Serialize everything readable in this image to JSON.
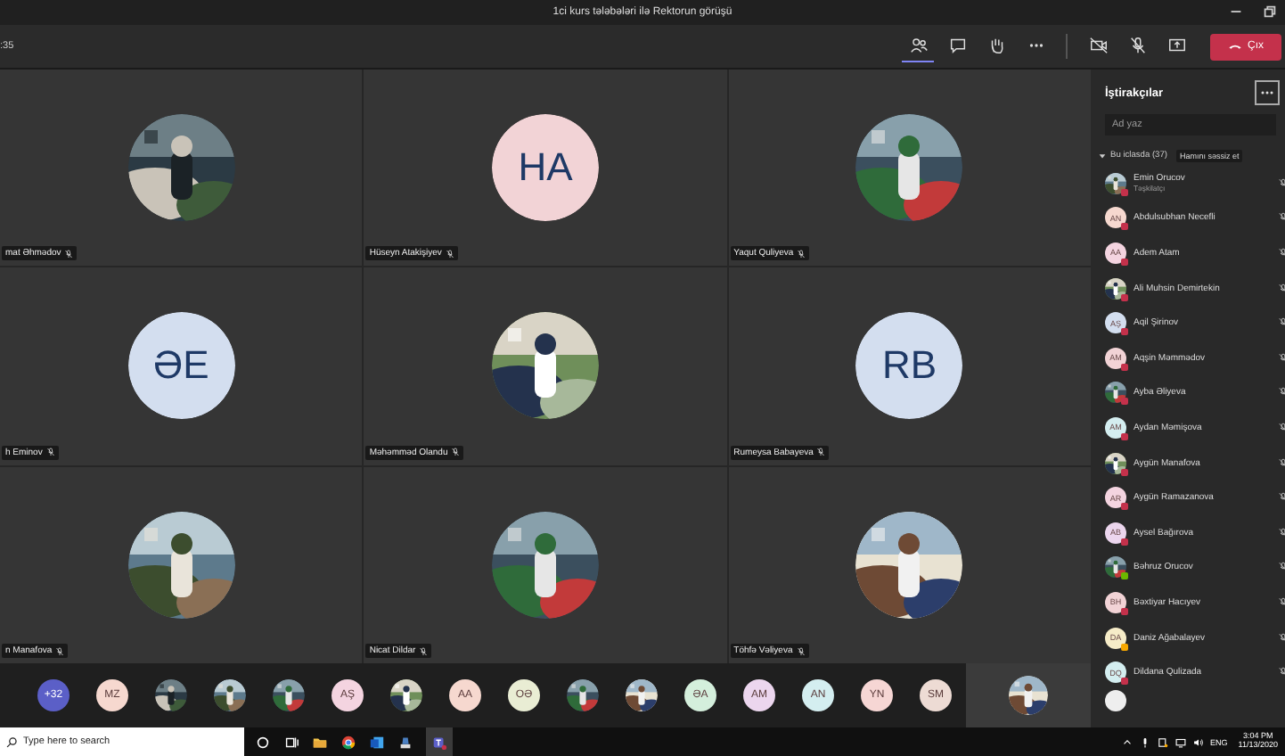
{
  "window": {
    "title": "1ci kurs tələbələri ilə Rektorun görüşü"
  },
  "toolbar": {
    "timer": ":35",
    "panel_buttons": [
      {
        "kind": "participants",
        "selected": true
      },
      {
        "kind": "chat",
        "selected": false
      },
      {
        "kind": "raise_hand",
        "selected": false
      },
      {
        "kind": "more",
        "selected": false
      }
    ],
    "leave_button": "Çıx"
  },
  "tiles": [
    {
      "name": "mat Əhmədov",
      "kind": "picture"
    },
    {
      "name": "Hüseyn Atakişiyev",
      "kind": "initials",
      "initials": "HA",
      "color": "#f2d3d6"
    },
    {
      "name": "Yaqut Quliyeva",
      "kind": "picture"
    },
    {
      "name": "h Eminov",
      "kind": "initials",
      "initials": "ƏE",
      "color": "#d3deef"
    },
    {
      "name": "Məhəmməd Olandu",
      "kind": "picture"
    },
    {
      "name": "Rumeysa Babayeva",
      "kind": "initials",
      "initials": "RB",
      "color": "#d3deef"
    },
    {
      "name": "n Manafova",
      "kind": "picture"
    },
    {
      "name": "Nicat Dildar",
      "kind": "picture"
    },
    {
      "name": "Töhfə Vəliyeva",
      "kind": "picture"
    }
  ],
  "strip": [
    {
      "kind": "count",
      "text": "+32",
      "color": "#5b5fc7"
    },
    {
      "kind": "initials",
      "text": "MZ",
      "color": "#f6d8cf"
    },
    {
      "kind": "picture"
    },
    {
      "kind": "picture"
    },
    {
      "kind": "picture"
    },
    {
      "kind": "initials",
      "text": "AŞ",
      "color": "#f4d4e0"
    },
    {
      "kind": "picture"
    },
    {
      "kind": "initials",
      "text": "AA",
      "color": "#f6d8cf"
    },
    {
      "kind": "initials",
      "text": "OƏ",
      "color": "#e9edd4"
    },
    {
      "kind": "picture"
    },
    {
      "kind": "picture"
    },
    {
      "kind": "initials",
      "text": "ƏA",
      "color": "#d4efdc"
    },
    {
      "kind": "initials",
      "text": "AM",
      "color": "#ecd6ee"
    },
    {
      "kind": "initials",
      "text": "AN",
      "color": "#d4eef0"
    },
    {
      "kind": "initials",
      "text": "YN",
      "color": "#f6d6d4"
    },
    {
      "kind": "initials",
      "text": "SM",
      "color": "#eddbd4"
    }
  ],
  "panel": {
    "title": "İştirakçılar",
    "search": {
      "placeholder": "Ad yaz"
    },
    "section": "Bu iclasda (37)",
    "tooltip": "Hamını səssiz et",
    "participants": [
      {
        "name": "Emin Orucov",
        "role": "Təşkilatçı",
        "kind": "picture",
        "color": "#c4314b"
      },
      {
        "name": "Abdulsubhan Necefli",
        "kind": "initials",
        "initials": "AN",
        "color": "#c4314b"
      },
      {
        "name": "Adem Atam",
        "kind": "initials",
        "initials": "AA",
        "color": "#c4314b"
      },
      {
        "name": "Ali Muhsin Demirtekin",
        "kind": "picture",
        "color": "#c4314b"
      },
      {
        "name": "Aqil Şirinov",
        "kind": "initials",
        "initials": "AŞ",
        "color": "#c4314b"
      },
      {
        "name": "Aqşin Məmmədov",
        "kind": "initials",
        "initials": "AM",
        "color": "#c4314b"
      },
      {
        "name": "Ayba Əliyeva",
        "kind": "picture",
        "color": "#c4314b"
      },
      {
        "name": "Aydan Məmişova",
        "kind": "initials",
        "initials": "AM",
        "color": "#c4314b"
      },
      {
        "name": "Aygün Manafova",
        "kind": "picture",
        "color": "#c4314b"
      },
      {
        "name": "Aygün Ramazanova",
        "kind": "initials",
        "initials": "AR",
        "color": "#c4314b"
      },
      {
        "name": "Aysel Bağırova",
        "kind": "initials",
        "initials": "AB",
        "color": "#c4314b"
      },
      {
        "name": "Bəhruz Orucov",
        "kind": "picture",
        "color": "#6bb700"
      },
      {
        "name": "Bəxtiyar Hacıyev",
        "kind": "initials",
        "initials": "BH",
        "color": "#c4314b"
      },
      {
        "name": "Daniz Ağabalayev",
        "kind": "initials",
        "initials": "DA",
        "color": "#f8a800"
      },
      {
        "name": "Dildana Qulizada",
        "kind": "initials",
        "initials": "DQ",
        "color": "#c4314b"
      }
    ]
  },
  "taskbar": {
    "search": {
      "placeholder": "Type here to search"
    },
    "language": "ENG",
    "time": "3:04 PM",
    "date": "11/13/2020"
  }
}
